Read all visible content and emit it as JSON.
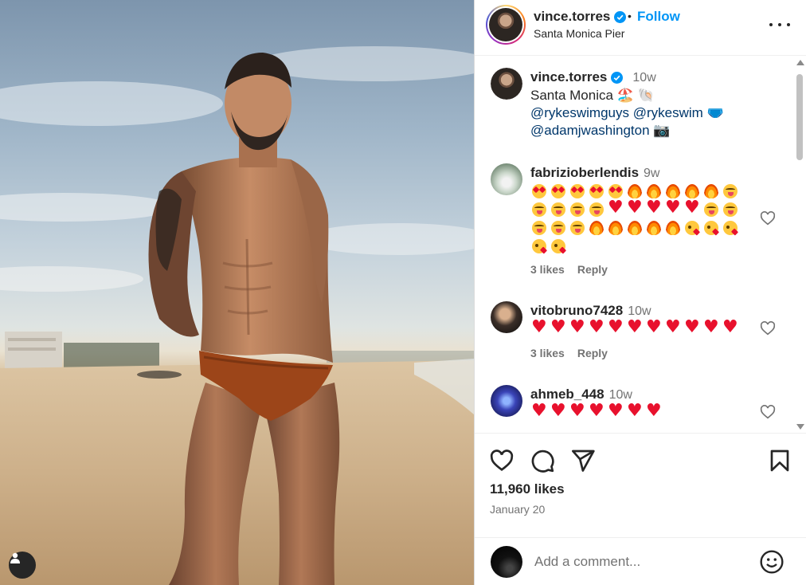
{
  "post": {
    "username": "vince.torres",
    "follow_label": "Follow",
    "dot": "•",
    "location": "Santa Monica Pier"
  },
  "caption": {
    "username": "vince.torres",
    "time": "10w",
    "line1": "Santa Monica 🏖️ 🐚",
    "mention1": "@rykeswimguys",
    "mention2": "@rykeswim",
    "mention2_emoji": "🩲",
    "mention3": "@adamjwashington",
    "mention3_emoji": "📷"
  },
  "comments": [
    {
      "username": "fabrizioberlendis",
      "time": "9w",
      "emoji_rows": [
        [
          "hearteyes",
          "hearteyes",
          "hearteyes",
          "hearteyes",
          "hearteyes",
          "fire",
          "fire",
          "fire",
          "fire",
          "fire",
          "yum"
        ],
        [
          "yum",
          "yum",
          "yum",
          "yum",
          "heart",
          "heart",
          "heart",
          "heart",
          "heart",
          "yum",
          "yum"
        ],
        [
          "yum",
          "yum",
          "yum",
          "fire",
          "fire",
          "fire",
          "fire",
          "fire",
          "kiss",
          "kiss",
          "kiss"
        ],
        [
          "kiss",
          "kiss"
        ]
      ],
      "likes": "3 likes",
      "reply": "Reply"
    },
    {
      "username": "vitobruno7428",
      "time": "10w",
      "emoji_rows": [
        [
          "heart",
          "heart",
          "heart",
          "heart",
          "heart",
          "heart",
          "heart",
          "heart",
          "heart",
          "heart",
          "heart"
        ]
      ],
      "likes": "3 likes",
      "reply": "Reply"
    },
    {
      "username": "ahmeb_448",
      "time": "10w",
      "emoji_rows": [
        [
          "heart",
          "heart",
          "heart",
          "heart",
          "heart",
          "heart",
          "heart"
        ]
      ]
    }
  ],
  "likes_count": "11,960 likes",
  "date": "January 20",
  "add_comment_placeholder": "Add a comment...",
  "icons": {
    "like": "heart-outline-icon",
    "comment": "comment-bubble-icon",
    "share": "paper-plane-icon",
    "save": "bookmark-icon",
    "more": "more-dots-icon",
    "verified": "verified-badge-icon",
    "emoji": "smiley-icon",
    "user_tag": "person-icon"
  },
  "colors": {
    "link_blue": "#0095f6",
    "verified_blue": "#0095f6",
    "mention_blue": "#00376b",
    "muted_gray": "#737373"
  }
}
